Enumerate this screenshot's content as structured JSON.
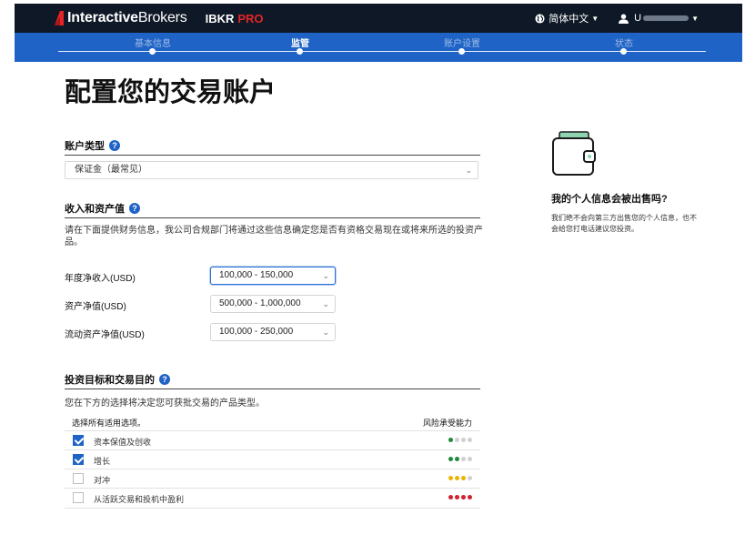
{
  "header": {
    "logo_bold": "Interactive",
    "logo_light": "Brokers",
    "product": "IBKR",
    "product_suffix": "PRO",
    "language": "简体中文",
    "user_prefix": "U"
  },
  "steps": [
    {
      "label": "基本信息",
      "active": false
    },
    {
      "label": "监管",
      "active": true
    },
    {
      "label": "账户设置",
      "active": false
    },
    {
      "label": "状态",
      "active": false
    }
  ],
  "page": {
    "title": "配置您的交易账户"
  },
  "account_type": {
    "heading": "账户类型",
    "selected": "保证金（最常见）"
  },
  "income": {
    "heading": "收入和资产值",
    "description": "请在下面提供财务信息，我公司合规部门将通过这些信息确定您是否有资格交易现在或将来所选的投资产品。",
    "fields": [
      {
        "label": "年度净收入(USD)",
        "value": "100,000 - 150,000"
      },
      {
        "label": "资产净值(USD)",
        "value": "500,000 - 1,000,000"
      },
      {
        "label": "流动资产净值(USD)",
        "value": "100,000 - 250,000"
      }
    ]
  },
  "objectives": {
    "heading": "投资目标和交易目的",
    "description": "您在下方的选择将决定您可获批交易的产品类型。",
    "col_select": "选择所有适用选项。",
    "col_risk": "风险承受能力",
    "rows": [
      {
        "label": "资本保值及创收",
        "checked": true,
        "risk": 1,
        "color": "#1f8a3b"
      },
      {
        "label": "增长",
        "checked": true,
        "risk": 2,
        "color": "#1f8a3b"
      },
      {
        "label": "对冲",
        "checked": false,
        "risk": 3,
        "color": "#e8b400"
      },
      {
        "label": "从活跃交易和投机中盈利",
        "checked": false,
        "risk": 4,
        "color": "#d0202e"
      }
    ]
  },
  "sidebar": {
    "title": "我的个人信息会被出售吗?",
    "text": "我们绝不会向第三方出售您的个人信息，也不会给您打电话建议您投资。"
  },
  "colors": {
    "topbar": "#0e1826",
    "stepbar": "#1f63c6",
    "accent_red": "#e52525",
    "wallet_green": "#8fd4b0"
  }
}
